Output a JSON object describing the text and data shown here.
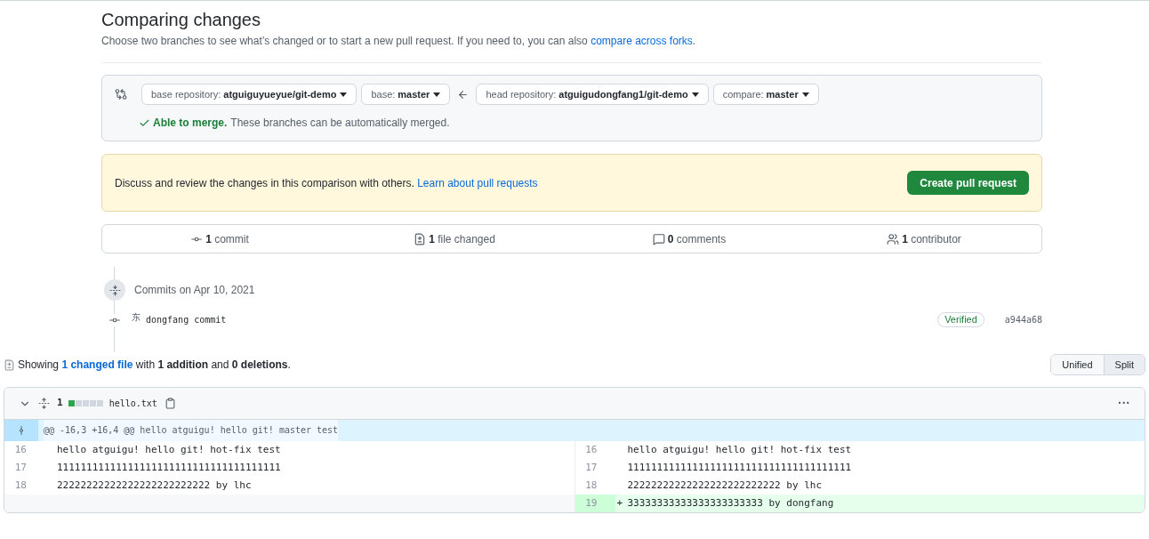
{
  "header": {
    "title": "Comparing changes",
    "subtitle": "Choose two branches to see what’s changed or to start a new pull request. If you need to, you can also",
    "subtitle_link": "compare across forks",
    "subtitle_end": "."
  },
  "range": {
    "selectors": [
      {
        "label": "base repository:",
        "value": "atguiguyueyue/git-demo"
      },
      {
        "label": "base:",
        "value": "master"
      },
      {
        "label": "head repository:",
        "value": "atguigudongfang1/git-demo"
      },
      {
        "label": "compare:",
        "value": "master"
      }
    ],
    "merge_status": "Able to merge.",
    "merge_note": "These branches can be automatically merged."
  },
  "notice": {
    "text": "Discuss and review the changes in this comparison with others.",
    "link": "Learn about pull requests",
    "button": "Create pull request"
  },
  "stats": [
    {
      "kind": "commit",
      "count": "1",
      "label": "commit"
    },
    {
      "kind": "file",
      "count": "1",
      "label": "file changed"
    },
    {
      "kind": "comment",
      "count": "0",
      "label": "comments"
    },
    {
      "kind": "people",
      "count": "1",
      "label": "contributor"
    }
  ],
  "commits": {
    "date": "Commits on Apr 10, 2021",
    "items": [
      {
        "avatar": "东",
        "message": "dongfang commit",
        "badge": "Verified",
        "sha": "a944a68"
      }
    ]
  },
  "summary": {
    "prefix": "Showing",
    "link": "1 changed file",
    "text": "with **1 addition** and **0 deletions**."
  },
  "view_toggle": [
    {
      "label": "Unified",
      "selected": false
    },
    {
      "label": "Split",
      "selected": true
    }
  ],
  "file": {
    "count": "1",
    "diffstat": [
      {
        "kind": "added"
      },
      {
        "kind": "neutral"
      },
      {
        "kind": "neutral"
      },
      {
        "kind": "neutral"
      },
      {
        "kind": "neutral"
      }
    ],
    "name": "hello.txt",
    "menu": "···",
    "hunk": "@@ -16,3 +16,4 @@ hello atguigu! hello git! master test",
    "rows": [
      {
        "left": {
          "kind": "context",
          "num": "16",
          "text": "hello atguigu! hello git! hot-fix test"
        },
        "right": {
          "kind": "context",
          "num": "16",
          "text": "hello atguigu! hello git! hot-fix test"
        }
      },
      {
        "left": {
          "kind": "context",
          "num": "17",
          "text": "11111111111111111111111111111111111111"
        },
        "right": {
          "kind": "context",
          "num": "17",
          "text": "11111111111111111111111111111111111111"
        }
      },
      {
        "left": {
          "kind": "context",
          "num": "18",
          "text": "22222222222222222222222222 by lhc"
        },
        "right": {
          "kind": "context",
          "num": "18",
          "text": "22222222222222222222222222 by lhc"
        }
      },
      {
        "left": {
          "kind": "empty"
        },
        "right": {
          "kind": "added",
          "num": "19",
          "marker": "+",
          "text": "33333333333333333333333 by dongfang"
        }
      }
    ]
  }
}
